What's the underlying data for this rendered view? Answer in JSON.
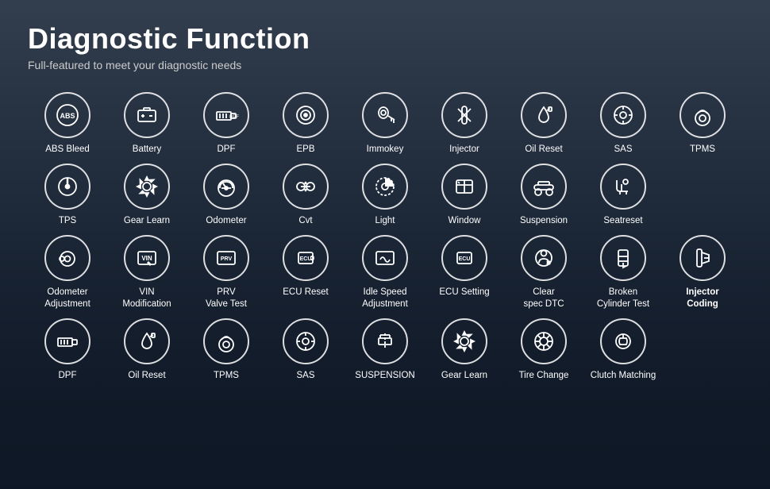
{
  "header": {
    "title": "Diagnostic Function",
    "subtitle": "Full-featured to meet your diagnostic needs"
  },
  "rows": [
    [
      {
        "label": "ABS Bleed",
        "icon": "abs",
        "bold": false
      },
      {
        "label": "Battery",
        "icon": "battery",
        "bold": false
      },
      {
        "label": "DPF",
        "icon": "dpf",
        "bold": false
      },
      {
        "label": "EPB",
        "icon": "epb",
        "bold": false
      },
      {
        "label": "Immokey",
        "icon": "immokey",
        "bold": false
      },
      {
        "label": "Injector",
        "icon": "injector",
        "bold": false
      },
      {
        "label": "Oil Reset",
        "icon": "oil_reset",
        "bold": false
      },
      {
        "label": "SAS",
        "icon": "sas",
        "bold": false
      },
      {
        "label": "TPMS",
        "icon": "tpms",
        "bold": false
      }
    ],
    [
      {
        "label": "TPS",
        "icon": "tps",
        "bold": false
      },
      {
        "label": "Gear Learn",
        "icon": "gear_learn",
        "bold": false
      },
      {
        "label": "Odometer",
        "icon": "odometer",
        "bold": false
      },
      {
        "label": "Cvt",
        "icon": "cvt",
        "bold": false
      },
      {
        "label": "Light",
        "icon": "light",
        "bold": false
      },
      {
        "label": "Window",
        "icon": "window",
        "bold": false
      },
      {
        "label": "Suspension",
        "icon": "suspension",
        "bold": false
      },
      {
        "label": "Seatreset",
        "icon": "seatreset",
        "bold": false
      },
      {
        "label": "",
        "icon": "empty",
        "bold": false
      }
    ],
    [
      {
        "label": "Odometer\nAdjustment",
        "icon": "odometer2",
        "bold": false
      },
      {
        "label": "VIN\nModification",
        "icon": "vin",
        "bold": false
      },
      {
        "label": "PRV\nValve Test",
        "icon": "prv",
        "bold": false
      },
      {
        "label": "ECU Reset",
        "icon": "ecu_reset",
        "bold": false
      },
      {
        "label": "Idle Speed\nAdjustment",
        "icon": "idle_speed",
        "bold": false
      },
      {
        "label": "ECU Setting",
        "icon": "ecu_setting",
        "bold": false
      },
      {
        "label": "Clear\nspec DTC",
        "icon": "clear_dtc",
        "bold": false
      },
      {
        "label": "Broken\nCylinder Test",
        "icon": "broken_cyl",
        "bold": false
      },
      {
        "label": "Injector\nCoding",
        "icon": "injector_coding",
        "bold": true
      }
    ],
    [
      {
        "label": "DPF",
        "icon": "dpf2",
        "bold": false
      },
      {
        "label": "Oil Reset",
        "icon": "oil_reset2",
        "bold": false
      },
      {
        "label": "TPMS",
        "icon": "tpms2",
        "bold": false
      },
      {
        "label": "SAS",
        "icon": "sas2",
        "bold": false
      },
      {
        "label": "SUSPENSION",
        "icon": "suspension2",
        "bold": false
      },
      {
        "label": "Gear Learn",
        "icon": "gear_learn2",
        "bold": false
      },
      {
        "label": "Tire Change",
        "icon": "tire_change",
        "bold": false
      },
      {
        "label": "Clutch Matching",
        "icon": "clutch",
        "bold": false
      },
      {
        "label": "",
        "icon": "empty2",
        "bold": false
      }
    ]
  ],
  "icons": {
    "abs": "ABS",
    "battery": "🔋",
    "dpf": "DPF",
    "epb": "⊙",
    "immokey": "🗝",
    "injector": "⊘",
    "oil_reset": "🛢",
    "sas": "🎡",
    "tpms": "◎",
    "tps": "◉",
    "gear_learn": "⚙",
    "odometer": "◎",
    "cvt": "≈",
    "light": "◑",
    "window": "▣",
    "suspension": "🚗",
    "seatreset": "💺",
    "odometer2": "⊙",
    "vin": "VIN",
    "prv": "PRV",
    "ecu_reset": "ECU",
    "idle_speed": "◈",
    "ecu_setting": "ECU",
    "clear_dtc": "⊕",
    "broken_cyl": "⊘",
    "injector_coding": "⊘",
    "dpf2": "DPF",
    "oil_reset2": "🛢",
    "tpms2": "◎",
    "sas2": "🎡",
    "suspension2": "⊕",
    "gear_learn2": "⚙",
    "tire_change": "◎",
    "clutch": "⊘"
  }
}
